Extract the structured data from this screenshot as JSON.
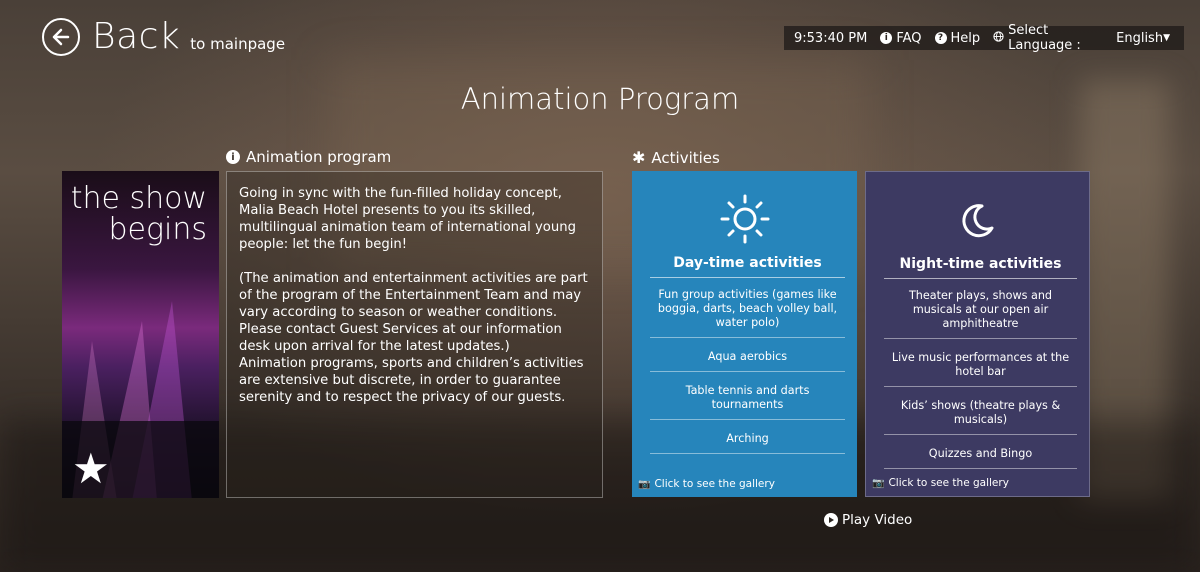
{
  "header": {
    "back_label": "Back",
    "back_sub": "to mainpage",
    "time": "9:53:40 PM",
    "faq": "FAQ",
    "help": "Help",
    "language_label": "Select Language :",
    "language_value": "English"
  },
  "page_title": "Animation Program",
  "program": {
    "heading": "Animation program",
    "poster_text_line1": "the show",
    "poster_text_line2": "begins",
    "paragraph1": "Going in sync with the fun-filled holiday concept, Malia Beach Hotel presents to you its skilled, multilingual animation team of international young people: let the fun begin!",
    "paragraph2": "(The animation and entertainment activities are part of the program of the Entertainment Team and may vary according to season or weather conditions. Please contact Guest Services at our information desk upon arrival for the latest updates.)",
    "paragraph3": "Animation programs, sports and children’s activities are extensive but discrete, in order to guarantee serenity and to respect the privacy of our guests."
  },
  "activities": {
    "heading": "Activities",
    "day": {
      "title": "Day-time activities",
      "color": "#2685bb",
      "items": [
        "Fun group activities (games like boggia, darts, beach volley ball, water polo)",
        "Aqua aerobics",
        "Table tennis and darts tournaments",
        "Arching"
      ],
      "gallery": "Click to see the gallery"
    },
    "night": {
      "title": "Night-time activities",
      "color": "#3d3a62",
      "items": [
        "Theater plays, shows and musicals at our open air amphitheatre",
        "Live music performances at the hotel bar",
        "Kids’ shows (theatre plays & musicals)",
        "Quizzes and Bingo"
      ],
      "gallery": "Click to see the gallery"
    },
    "play_video": "Play Video"
  }
}
